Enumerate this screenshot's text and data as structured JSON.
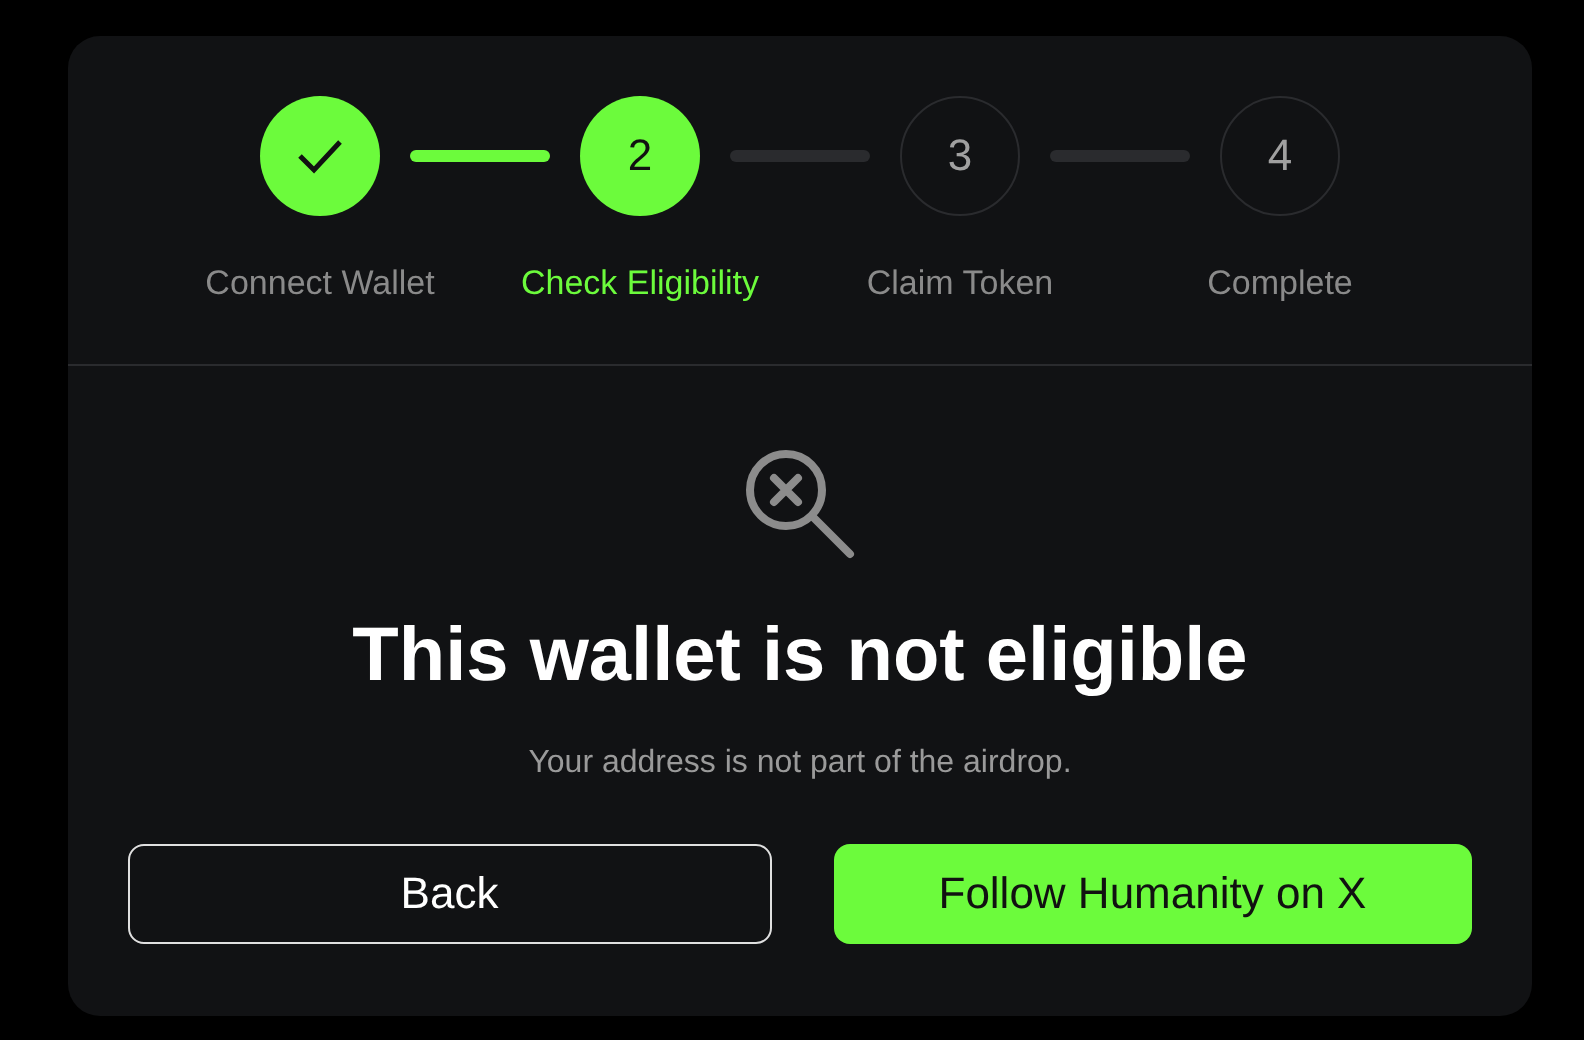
{
  "steps": [
    {
      "label": "Connect Wallet",
      "completed": true,
      "selected": false
    },
    {
      "label": "Check Eligibility",
      "number": "2",
      "completed": false,
      "selected": true
    },
    {
      "label": "Claim Token",
      "number": "3",
      "completed": false,
      "selected": false
    },
    {
      "label": "Complete",
      "number": "4",
      "completed": false,
      "selected": false
    }
  ],
  "result": {
    "title": "This wallet is not eligible",
    "message": "Your address is not part of the airdrop."
  },
  "buttons": [
    {
      "label": "Back",
      "kind": "secondary"
    },
    {
      "label": "Follow Humanity on X",
      "kind": "primary"
    }
  ]
}
